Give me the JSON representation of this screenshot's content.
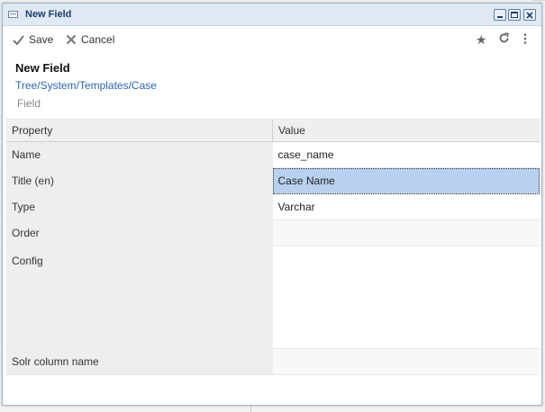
{
  "window": {
    "title": "New Field"
  },
  "toolbar": {
    "save_label": "Save",
    "cancel_label": "Cancel",
    "star_icon": "star-icon",
    "reload_icon": "reload-icon",
    "more_icon": "more-vertical-icon"
  },
  "header": {
    "title": "New Field",
    "path": "Tree/System/Templates/Case",
    "type": "Field"
  },
  "grid": {
    "columns": {
      "property": "Property",
      "value": "Value"
    },
    "rows": [
      {
        "property": "Name",
        "value": "case_name"
      },
      {
        "property": "Title (en)",
        "value": "Case Name",
        "selected": true
      },
      {
        "property": "Type",
        "value": "Varchar"
      },
      {
        "property": "Order",
        "value": ""
      },
      {
        "property": "Config",
        "value": ""
      },
      {
        "property": "Solr column name",
        "value": ""
      }
    ]
  },
  "colors": {
    "titlebar": "#dfe8f3",
    "title_text": "#1a3f73",
    "link": "#2a66b8",
    "selection": "#b9d1f0"
  }
}
